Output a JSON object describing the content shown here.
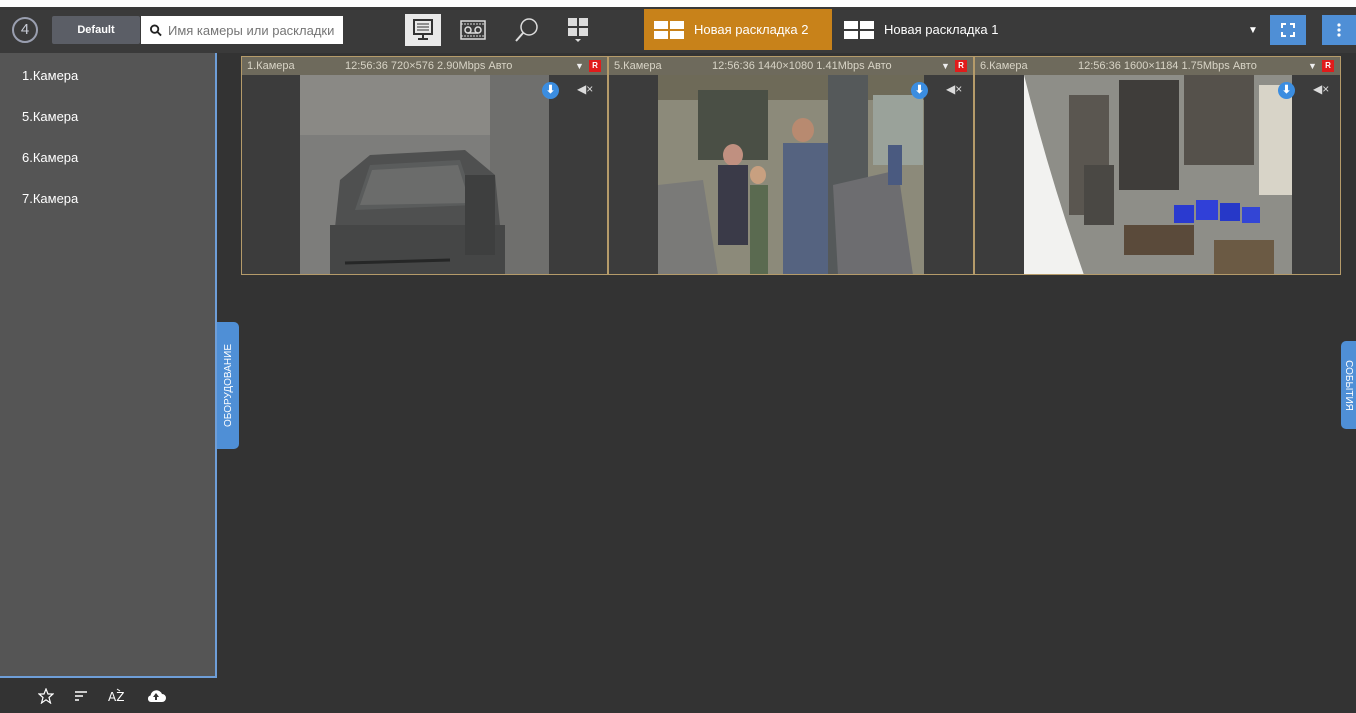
{
  "toolbar": {
    "logo_text": "4",
    "default_label": "Default",
    "search_placeholder": "Имя камеры или раскладки",
    "modes": [
      {
        "name": "live",
        "icon": "monitor-icon"
      },
      {
        "name": "archive",
        "icon": "tape-icon"
      },
      {
        "name": "search",
        "icon": "magnifier-icon"
      },
      {
        "name": "layouts",
        "icon": "grid-icon"
      }
    ],
    "layout_tabs": [
      {
        "label": "Новая раскладка 2",
        "active": true
      },
      {
        "label": "Новая раскладка 1",
        "active": false
      }
    ],
    "accent_color": "#c8821a"
  },
  "sidebar": {
    "items": [
      {
        "label": "1.Камера"
      },
      {
        "label": "5.Камера"
      },
      {
        "label": "6.Камера"
      },
      {
        "label": "7.Камера"
      }
    ],
    "footer_icons": [
      "star-icon",
      "sort-icon",
      "az-sort-icon",
      "cloud-upload-icon"
    ],
    "panel_tab": "ОБОРУДОВАНИЕ"
  },
  "events_tab": "СОБЫТИЯ",
  "tiles": [
    {
      "name": "1.Камера",
      "info": "12:56:36  720×576 2.90Mbps Авто",
      "rec": "R"
    },
    {
      "name": "5.Камера",
      "info": "12:56:36  1440×1080 1.41Mbps Авто",
      "rec": "R"
    },
    {
      "name": "6.Камера",
      "info": "12:56:36  1600×1184 1.75Mbps Авто",
      "rec": "R"
    }
  ]
}
